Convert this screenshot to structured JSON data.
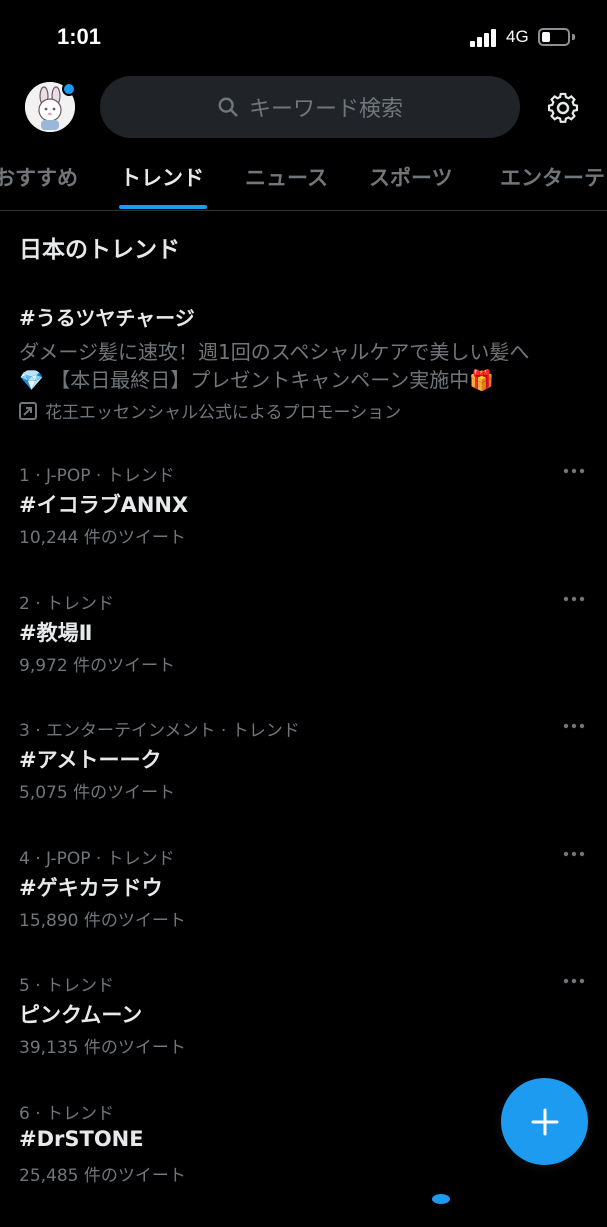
{
  "status_bar": {
    "time": "1:01",
    "network": "4G",
    "battery_level": 0.35
  },
  "header": {
    "search_placeholder": "キーワード検索"
  },
  "tabs": [
    {
      "label": "おすすめ",
      "active": false
    },
    {
      "label": "トレンド",
      "active": true
    },
    {
      "label": "ニュース",
      "active": false
    },
    {
      "label": "スポーツ",
      "active": false
    },
    {
      "label": "エンターテ",
      "active": false
    }
  ],
  "section": {
    "title": "日本のトレンド"
  },
  "promoted": {
    "title": "#うるツヤチャージ",
    "description_line1": "ダメージ髪に速攻！週1回のスペシャルケアで美しい髪へ",
    "description_line2": "💎 【本日最終日】プレゼントキャンペーン実施中🎁",
    "promoted_by": "花王エッセンシャル公式によるプロモーション"
  },
  "trends": [
    {
      "meta": "1 · J-POP · トレンド",
      "name": "#イコラブANNX",
      "count": "10,244 件のツイート"
    },
    {
      "meta": "2 · トレンド",
      "name": "#教場Ⅱ",
      "count": "9,972 件のツイート"
    },
    {
      "meta": "3 · エンターテインメント · トレンド",
      "name": "#アメトーーク",
      "count": "5,075 件のツイート"
    },
    {
      "meta": "4 · J-POP · トレンド",
      "name": "#ゲキカラドウ",
      "count": "15,890 件のツイート"
    },
    {
      "meta": "5 · トレンド",
      "name": "ピンクムーン",
      "count": "39,135 件のツイート"
    },
    {
      "meta": "6 · トレンド",
      "name": "#DrSTONE",
      "count": "25,485 件のツイート"
    }
  ],
  "colors": {
    "background": "#000000",
    "accent": "#1d9bf0",
    "primary_text": "#e7e9ea",
    "secondary_text": "#71767b",
    "search_bg": "#202327"
  },
  "icons": {
    "search": "search-icon",
    "settings": "gear-icon",
    "more": "more-icon",
    "promoted": "promoted-arrow-icon",
    "compose": "plus-icon"
  }
}
